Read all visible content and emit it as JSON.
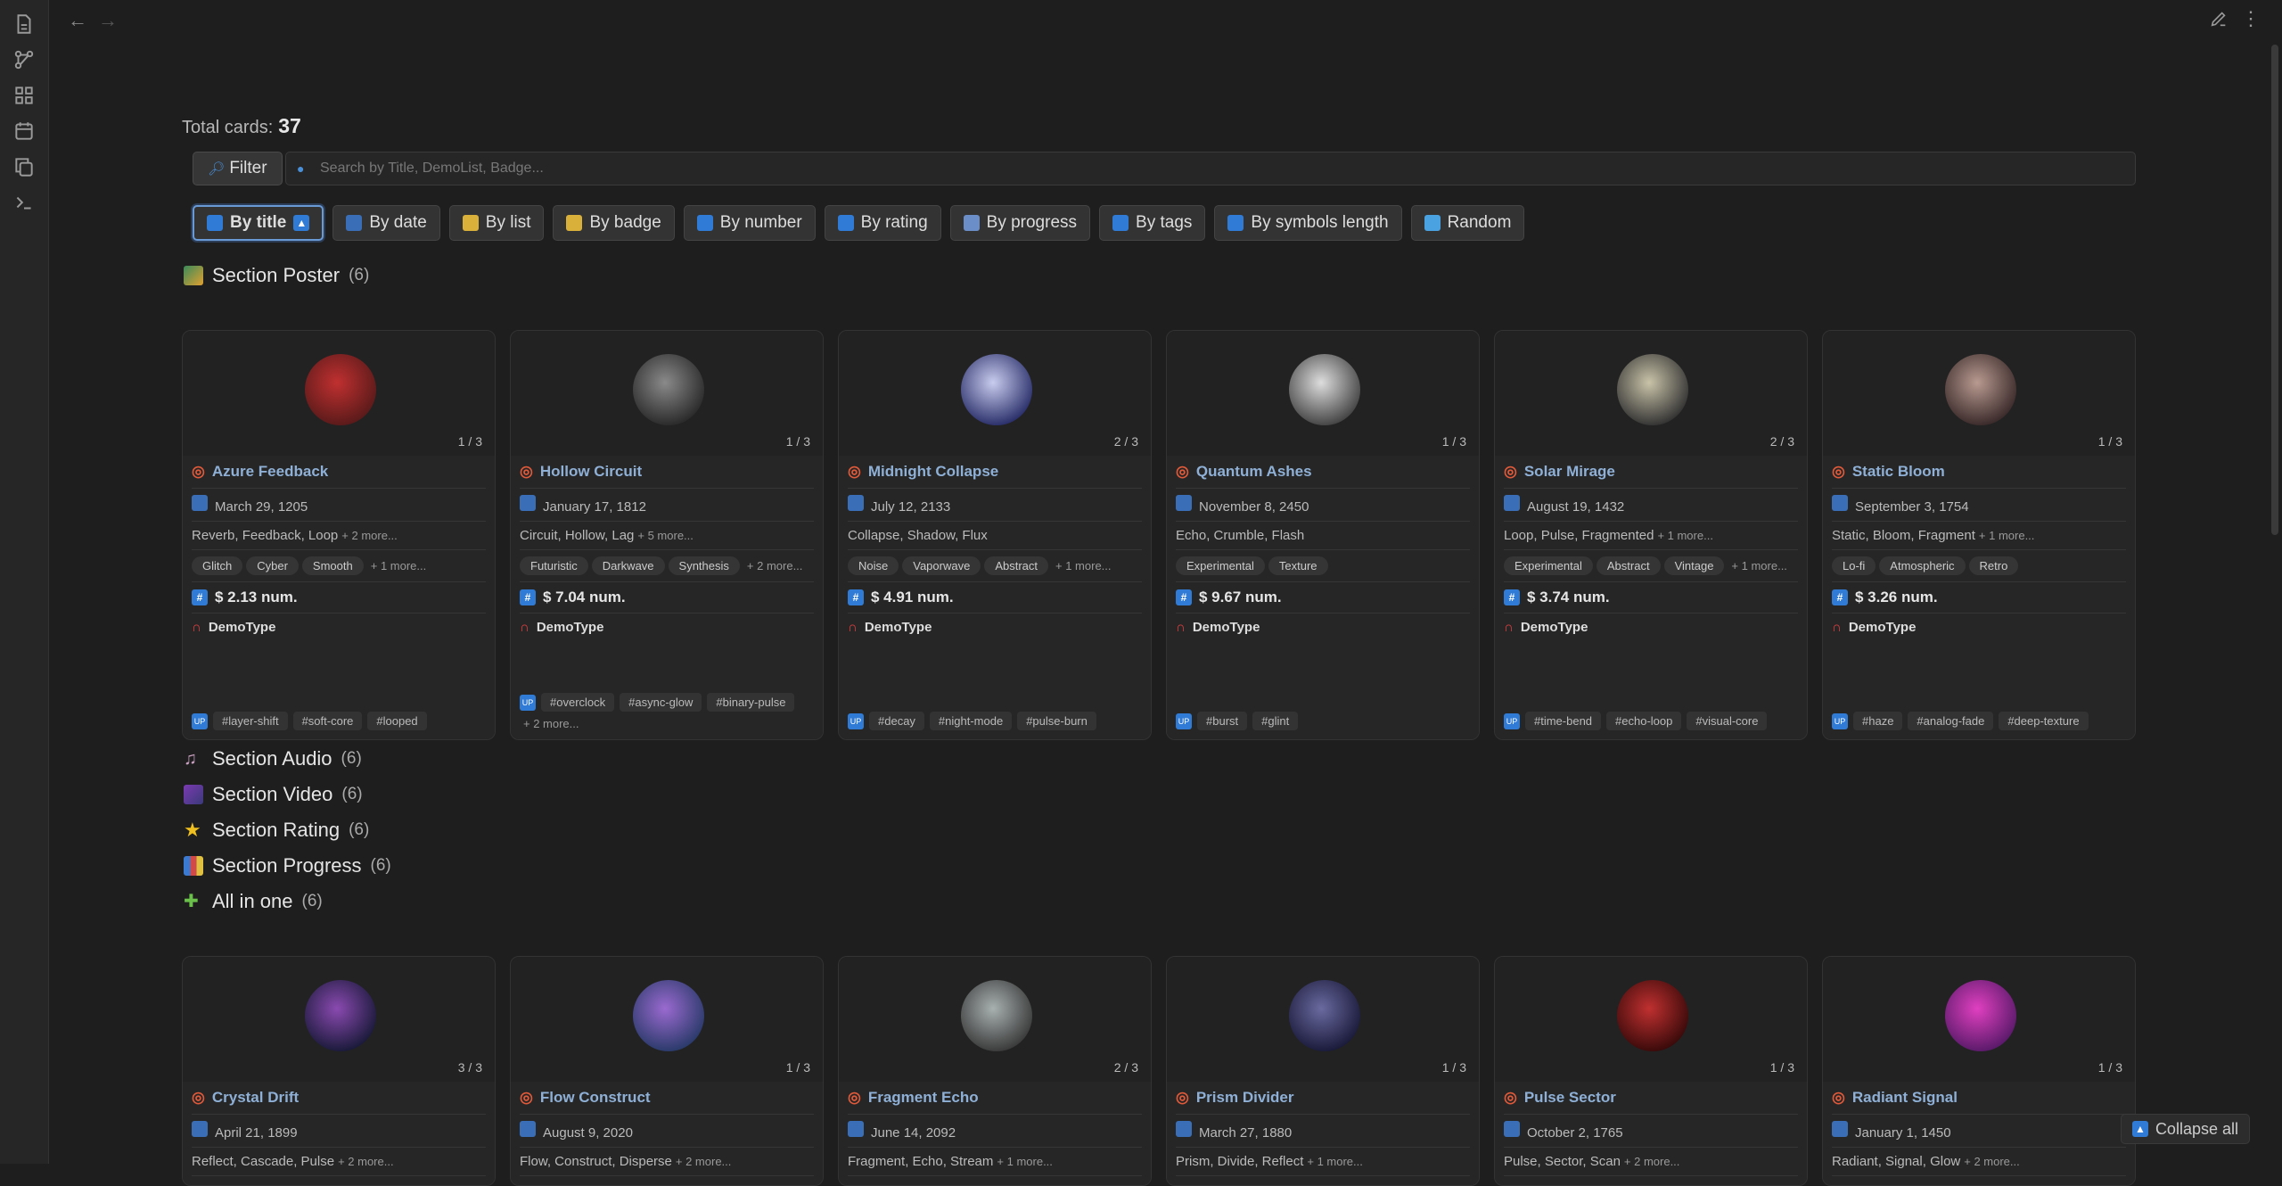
{
  "total": {
    "label": "Total cards:",
    "value": "37"
  },
  "filter": {
    "label": "Filter"
  },
  "search": {
    "placeholder": "Search by Title, DemoList, Badge..."
  },
  "sorts": [
    {
      "label": "By title",
      "icon_color": "#2f7bd6",
      "active": true
    },
    {
      "label": "By date",
      "icon_color": "#3a6fb8"
    },
    {
      "label": "By list",
      "icon_color": "#d9b03a"
    },
    {
      "label": "By badge",
      "icon_color": "#d9b03a"
    },
    {
      "label": "By number",
      "icon_color": "#2f7bd6"
    },
    {
      "label": "By rating",
      "icon_color": "#2f7bd6"
    },
    {
      "label": "By progress",
      "icon_color": "#6b8ec9"
    },
    {
      "label": "By tags",
      "icon_color": "#2f7bd6"
    },
    {
      "label": "By symbols length",
      "icon_color": "#2f7bd6"
    },
    {
      "label": "Random",
      "icon_color": "#4aa3e0"
    }
  ],
  "sections": {
    "poster": {
      "title": "Section Poster",
      "count": "(6)"
    },
    "audio": {
      "title": "Section Audio",
      "count": "(6)"
    },
    "video": {
      "title": "Section Video",
      "count": "(6)"
    },
    "rating": {
      "title": "Section Rating",
      "count": "(6)"
    },
    "progress": {
      "title": "Section Progress",
      "count": "(6)"
    },
    "allinone": {
      "title": "All in one",
      "count": "(6)"
    }
  },
  "cards_top": [
    {
      "pager": "1 / 3",
      "title": "Azure Feedback",
      "date": "March 29, 1205",
      "list": "Reverb, Feedback, Loop",
      "list_more": "+ 2 more...",
      "badges": [
        "Glitch",
        "Cyber",
        "Smooth"
      ],
      "badges_more": "+ 1 more...",
      "price": "$ 2.13 num.",
      "type": "DemoType",
      "tags": [
        "#layer-shift",
        "#soft-core",
        "#looped"
      ],
      "tags_more": "",
      "avatar": [
        "#5a1a1a",
        "#c03030"
      ]
    },
    {
      "pager": "1 / 3",
      "title": "Hollow Circuit",
      "date": "January 17, 1812",
      "list": "Circuit, Hollow, Lag",
      "list_more": "+ 5 more...",
      "badges": [
        "Futuristic",
        "Darkwave",
        "Synthesis"
      ],
      "badges_more": "+ 2 more...",
      "price": "$ 7.04 num.",
      "type": "DemoType",
      "tags": [
        "#overclock",
        "#async-glow",
        "#binary-pulse"
      ],
      "tags_more": "+ 2 more...",
      "avatar": [
        "#2a2a2a",
        "#8a8a8a"
      ]
    },
    {
      "pager": "2 / 3",
      "title": "Midnight Collapse",
      "date": "July 12, 2133",
      "list": "Collapse, Shadow, Flux",
      "list_more": "",
      "badges": [
        "Noise",
        "Vaporwave",
        "Abstract"
      ],
      "badges_more": "+ 1 more...",
      "price": "$ 4.91 num.",
      "type": "DemoType",
      "tags": [
        "#decay",
        "#night-mode",
        "#pulse-burn"
      ],
      "tags_more": "",
      "avatar": [
        "#2a2f6a",
        "#c8ccee"
      ]
    },
    {
      "pager": "1 / 3",
      "title": "Quantum Ashes",
      "date": "November 8, 2450",
      "list": "Echo, Crumble, Flash",
      "list_more": "",
      "badges": [
        "Experimental",
        "Texture"
      ],
      "badges_more": "",
      "price": "$ 9.67 num.",
      "type": "DemoType",
      "tags": [
        "#burst",
        "#glint"
      ],
      "tags_more": "",
      "avatar": [
        "#444",
        "#ddd"
      ]
    },
    {
      "pager": "2 / 3",
      "title": "Solar Mirage",
      "date": "August 19, 1432",
      "list": "Loop, Pulse, Fragmented",
      "list_more": "+ 1 more...",
      "badges": [
        "Experimental",
        "Abstract",
        "Vintage"
      ],
      "badges_more": "+ 1 more...",
      "price": "$ 3.74 num.",
      "type": "DemoType",
      "tags": [
        "#time-bend",
        "#echo-loop",
        "#visual-core"
      ],
      "tags_more": "",
      "avatar": [
        "#333",
        "#c9c3a8"
      ]
    },
    {
      "pager": "1 / 3",
      "title": "Static Bloom",
      "date": "September 3, 1754",
      "list": "Static, Bloom, Fragment",
      "list_more": "+ 1 more...",
      "badges": [
        "Lo-fi",
        "Atmospheric",
        "Retro"
      ],
      "badges_more": "",
      "price": "$ 3.26 num.",
      "type": "DemoType",
      "tags": [
        "#haze",
        "#analog-fade",
        "#deep-texture"
      ],
      "tags_more": "",
      "avatar": [
        "#3a2a2a",
        "#b89a90"
      ]
    }
  ],
  "cards_bottom": [
    {
      "pager": "3 / 3",
      "title": "Crystal Drift",
      "date": "April 21, 1899",
      "list": "Reflect, Cascade, Pulse",
      "list_more": "+ 2 more...",
      "avatar": [
        "#1a1a3a",
        "#8a4ab0"
      ]
    },
    {
      "pager": "1 / 3",
      "title": "Flow Construct",
      "date": "August 9, 2020",
      "list": "Flow, Construct, Disperse",
      "list_more": "+ 2 more...",
      "avatar": [
        "#2a3a6a",
        "#9a6ad0"
      ]
    },
    {
      "pager": "2 / 3",
      "title": "Fragment Echo",
      "date": "June 14, 2092",
      "list": "Fragment, Echo, Stream",
      "list_more": "+ 1 more...",
      "avatar": [
        "#3a3a3a",
        "#a8b0b0"
      ]
    },
    {
      "pager": "1 / 3",
      "title": "Prism Divider",
      "date": "March 27, 1880",
      "list": "Prism, Divide, Reflect",
      "list_more": "+ 1 more...",
      "avatar": [
        "#1a1a3a",
        "#6a6aa0"
      ]
    },
    {
      "pager": "1 / 3",
      "title": "Pulse Sector",
      "date": "October 2, 1765",
      "list": "Pulse, Sector, Scan",
      "list_more": "+ 2 more...",
      "avatar": [
        "#3a0a0a",
        "#c03030"
      ]
    },
    {
      "pager": "1 / 3",
      "title": "Radiant Signal",
      "date": "January 1, 1450",
      "list": "Radiant, Signal, Glow",
      "list_more": "+ 2 more...",
      "avatar": [
        "#5a1a6a",
        "#e040c0"
      ]
    }
  ],
  "collapse": {
    "label": "Collapse all"
  }
}
